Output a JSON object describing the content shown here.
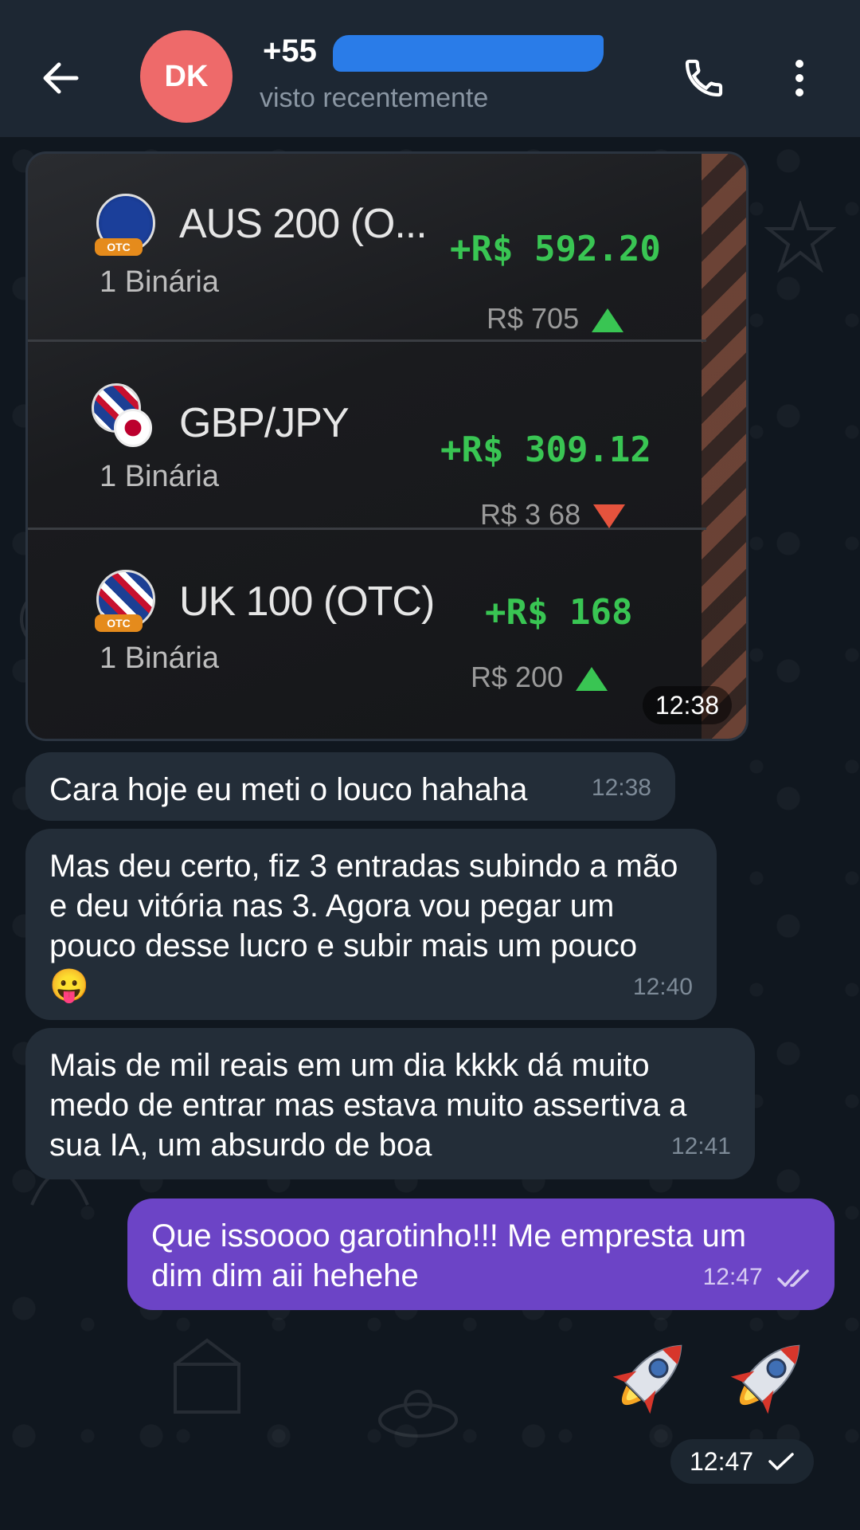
{
  "header": {
    "avatar_initials": "DK",
    "contact_name": "+55",
    "contact_status": "visto recentemente"
  },
  "photo_message": {
    "time": "12:38",
    "trades": [
      {
        "asset": "AUS 200 (O...",
        "type": "1 Binária",
        "profit": "+R$ 592.20",
        "stake": "R$ 705",
        "direction": "up",
        "flag": "australia",
        "otc_tag": "OTC"
      },
      {
        "asset": "GBP/JPY",
        "type": "1 Binária",
        "profit": "+R$ 309.12",
        "stake": "R$ 3 68",
        "direction": "down",
        "flag": "uk-japan"
      },
      {
        "asset": "UK 100 (OTC)",
        "type": "1 Binária",
        "profit": "+R$ 168",
        "stake": "R$ 200",
        "direction": "up",
        "flag": "uk",
        "otc_tag": "OTC"
      }
    ]
  },
  "messages": [
    {
      "text": "Cara hoje eu meti o louco hahaha",
      "time": "12:38",
      "direction": "incoming"
    },
    {
      "text": "Mas deu certo, fiz 3 entradas subindo a mão e deu vitória nas 3. Agora vou pegar um pouco desse lucro e subir mais um pouco 😛",
      "time": "12:40",
      "direction": "incoming"
    },
    {
      "text": "Mais de mil reais em um dia kkkk dá muito medo de entrar mas estava muito assertiva a sua IA, um absurdo de boa",
      "time": "12:41",
      "direction": "incoming"
    },
    {
      "text": "Que issoooo garotinho!!! Me empresta um dim dim aii hehehe",
      "time": "12:47",
      "direction": "outgoing",
      "status": "read-double-check"
    }
  ],
  "sticker_message": {
    "stickers": [
      "rocket-icon",
      "rocket-icon"
    ],
    "time": "12:47",
    "status": "sent-single-check"
  },
  "colors": {
    "header_bg": "#1d2733",
    "chat_bg": "#10171f",
    "incoming_bubble": "#232d38",
    "outgoing_bubble": "#6c44c6",
    "avatar": "#ee6a6a",
    "profit_green": "#39c553",
    "loss_red": "#e5533d"
  }
}
